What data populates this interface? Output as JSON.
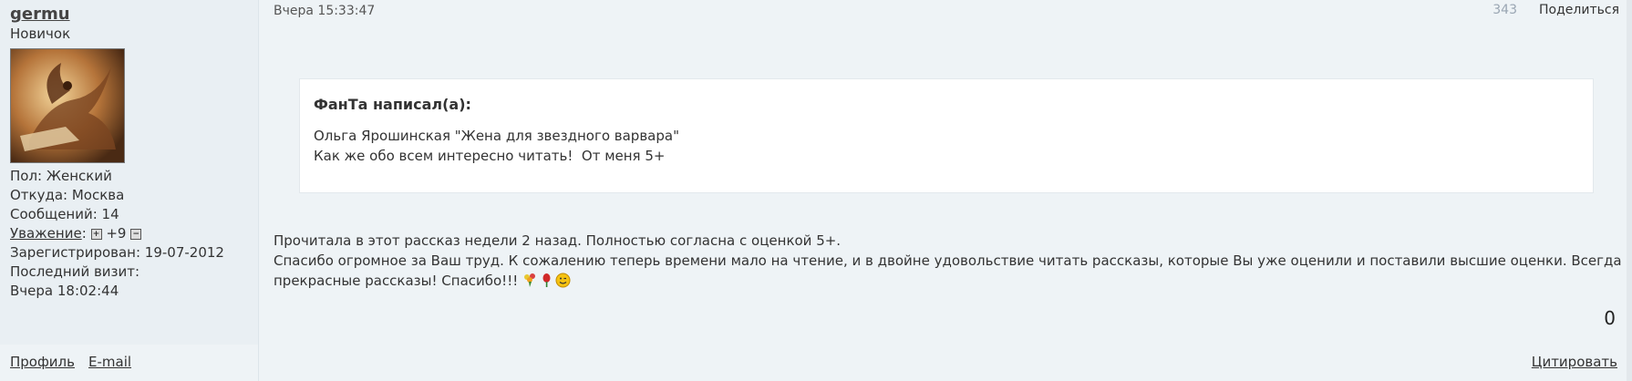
{
  "user": {
    "name": "germu",
    "rank": "Новичок",
    "gender": "Пол: Женский",
    "location": "Откуда: Москва",
    "messages": "Сообщений: 14",
    "reputation_label": "Уважение",
    "reputation_value": "+9",
    "registered": "Зарегистрирован: 19-07-2012",
    "last_visit_label": "Последний визит:",
    "last_visit_value": "Вчера 18:02:44"
  },
  "post": {
    "date": "Вчера 15:33:47",
    "number": "343",
    "share_label": "Поделиться",
    "quote": {
      "author": "ФанТа написал(а):",
      "line1": "Ольга Ярошинская \"Жена для звездного варвара\"",
      "line2": "Как же обо всем интересно читать!  От меня 5+"
    },
    "body": {
      "line1": "Прочитала в этот рассказ недели 2 назад. Полностью согласна с оценкой 5+.",
      "line2": "Спасибо огромное за Ваш труд. К сожалению теперь времени мало на чтение, и в двойне удовольствие читать рассказы, которые Вы уже оценили и поставили высшие оценки. Всегда прекрасные рассказы! Спасибо!!!"
    },
    "emojis": [
      "bouquet-icon",
      "rose-icon",
      "wink-smiley-icon"
    ],
    "votes": "0"
  },
  "footer": {
    "profile_label": "Профиль",
    "email_label": "E-mail",
    "quote_label": "Цитировать"
  },
  "colors": {
    "background": "#eef3f6",
    "sidebar": "#e9eff3",
    "quote_bg": "#ffffff",
    "muted_number": "#9aa6b3"
  }
}
